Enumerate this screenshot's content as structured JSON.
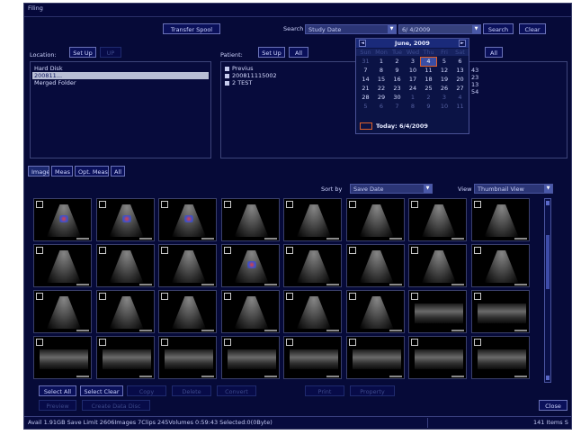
{
  "window": {
    "title": "Filing"
  },
  "toolbar": {
    "transfer_spool": "Transfer Spool",
    "search_label": "Search",
    "search_field": "Study Date",
    "date_value": "6/ 4/2009",
    "search_button": "Search",
    "clear_button": "Clear"
  },
  "location": {
    "label": "Location:",
    "setup_button": "Set Up",
    "up_button": "UP",
    "items": [
      "Hard Disk",
      "200811...",
      "Merged Folder"
    ]
  },
  "patient": {
    "label": "Patient:",
    "setup_button": "Set Up",
    "all_button": "All",
    "all_button2": "All",
    "items": [
      "Previus",
      "200811115002",
      "2 TEST"
    ],
    "counts": [
      "43",
      "23",
      "13",
      "54"
    ]
  },
  "calendar": {
    "month": "June, 2009",
    "prev": "◄",
    "next": "►",
    "weekdays": [
      "Sun",
      "Mon",
      "Tue",
      "Wed",
      "Thu",
      "Fri",
      "Sat"
    ],
    "weeks": [
      [
        "31",
        "1",
        "2",
        "3",
        "4",
        "5",
        "6"
      ],
      [
        "7",
        "8",
        "9",
        "10",
        "11",
        "12",
        "13"
      ],
      [
        "14",
        "15",
        "16",
        "17",
        "18",
        "19",
        "20"
      ],
      [
        "21",
        "22",
        "23",
        "24",
        "25",
        "26",
        "27"
      ],
      [
        "28",
        "29",
        "30",
        "1",
        "2",
        "3",
        "4"
      ],
      [
        "5",
        "6",
        "7",
        "8",
        "9",
        "10",
        "11"
      ]
    ],
    "today_label": "Today: 6/4/2009"
  },
  "tabs": [
    "Image",
    "Meas",
    "Opt. Meas",
    "All"
  ],
  "view": {
    "sort_label": "Sort by",
    "sort_value": "Save Date",
    "view_label": "View",
    "view_value": "Thumbnail View"
  },
  "actions": {
    "select_all": "Select All",
    "select_clear": "Select Clear",
    "copy": "Copy",
    "delete": "Delete",
    "convert": "Convert",
    "print": "Print",
    "property": "Property",
    "preview": "Preview",
    "create_data_disc": "Create Data Disc",
    "close": "Close"
  },
  "status": {
    "text": "Avail 1.91GB  Save Limit 2606Images  7Clips  245Volumes  0:59:43  Selected:0(0Byte)",
    "count": "141 Items S"
  }
}
